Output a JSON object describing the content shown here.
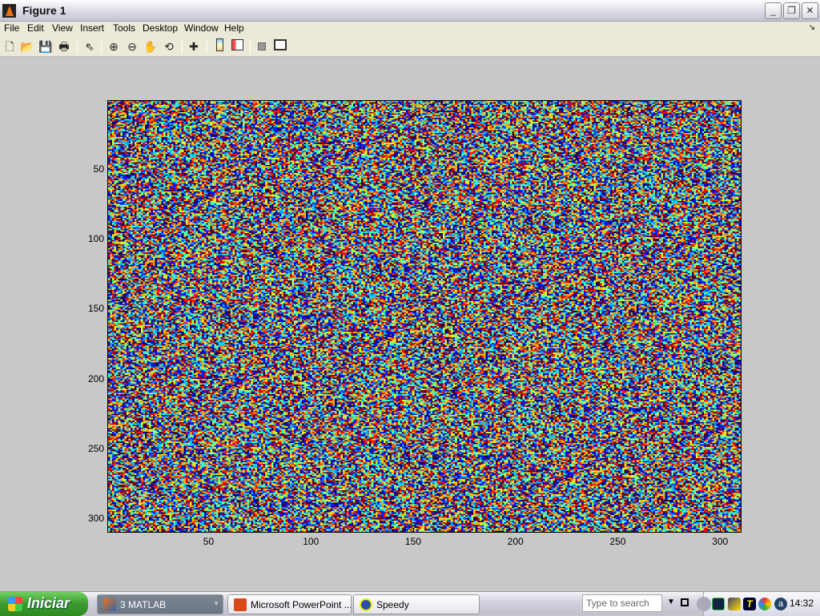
{
  "window": {
    "title": "Figure 1",
    "controls": [
      "minimize",
      "restore",
      "close"
    ]
  },
  "menu": [
    "File",
    "Edit",
    "View",
    "Insert",
    "Tools",
    "Desktop",
    "Window",
    "Help"
  ],
  "toolbar": [
    "new-file-icon",
    "open-folder-icon",
    "save-icon",
    "print-icon",
    "pointer-icon",
    "zoom-in-icon",
    "zoom-out-icon",
    "pan-hand-icon",
    "rotate-3d-icon",
    "data-cursor-icon",
    "colorbar-icon",
    "legend-icon",
    "hide-plot-tools-icon",
    "show-plot-tools-icon"
  ],
  "chart_data": {
    "type": "heatmap",
    "description_source": "image matrix of random values",
    "rows": 310,
    "cols": 310,
    "colormap": "jet",
    "xlim": [
      0.5,
      310.5
    ],
    "ylim": [
      0.5,
      310.5
    ],
    "y_direction": "reversed",
    "xticks": [
      "50",
      "100",
      "150",
      "200",
      "250",
      "300"
    ],
    "yticks": [
      "50",
      "100",
      "150",
      "200",
      "250",
      "300"
    ],
    "title": "",
    "xlabel": "",
    "ylabel": ""
  },
  "taskbar": {
    "start_label": "Iniciar",
    "tasks": [
      {
        "label": "3 MATLAB",
        "active": true
      },
      {
        "label": "Microsoft PowerPoint ...",
        "active": false
      },
      {
        "label": "Speedy",
        "active": false
      }
    ],
    "search_placeholder": "Type to search",
    "clock": "14:32"
  }
}
